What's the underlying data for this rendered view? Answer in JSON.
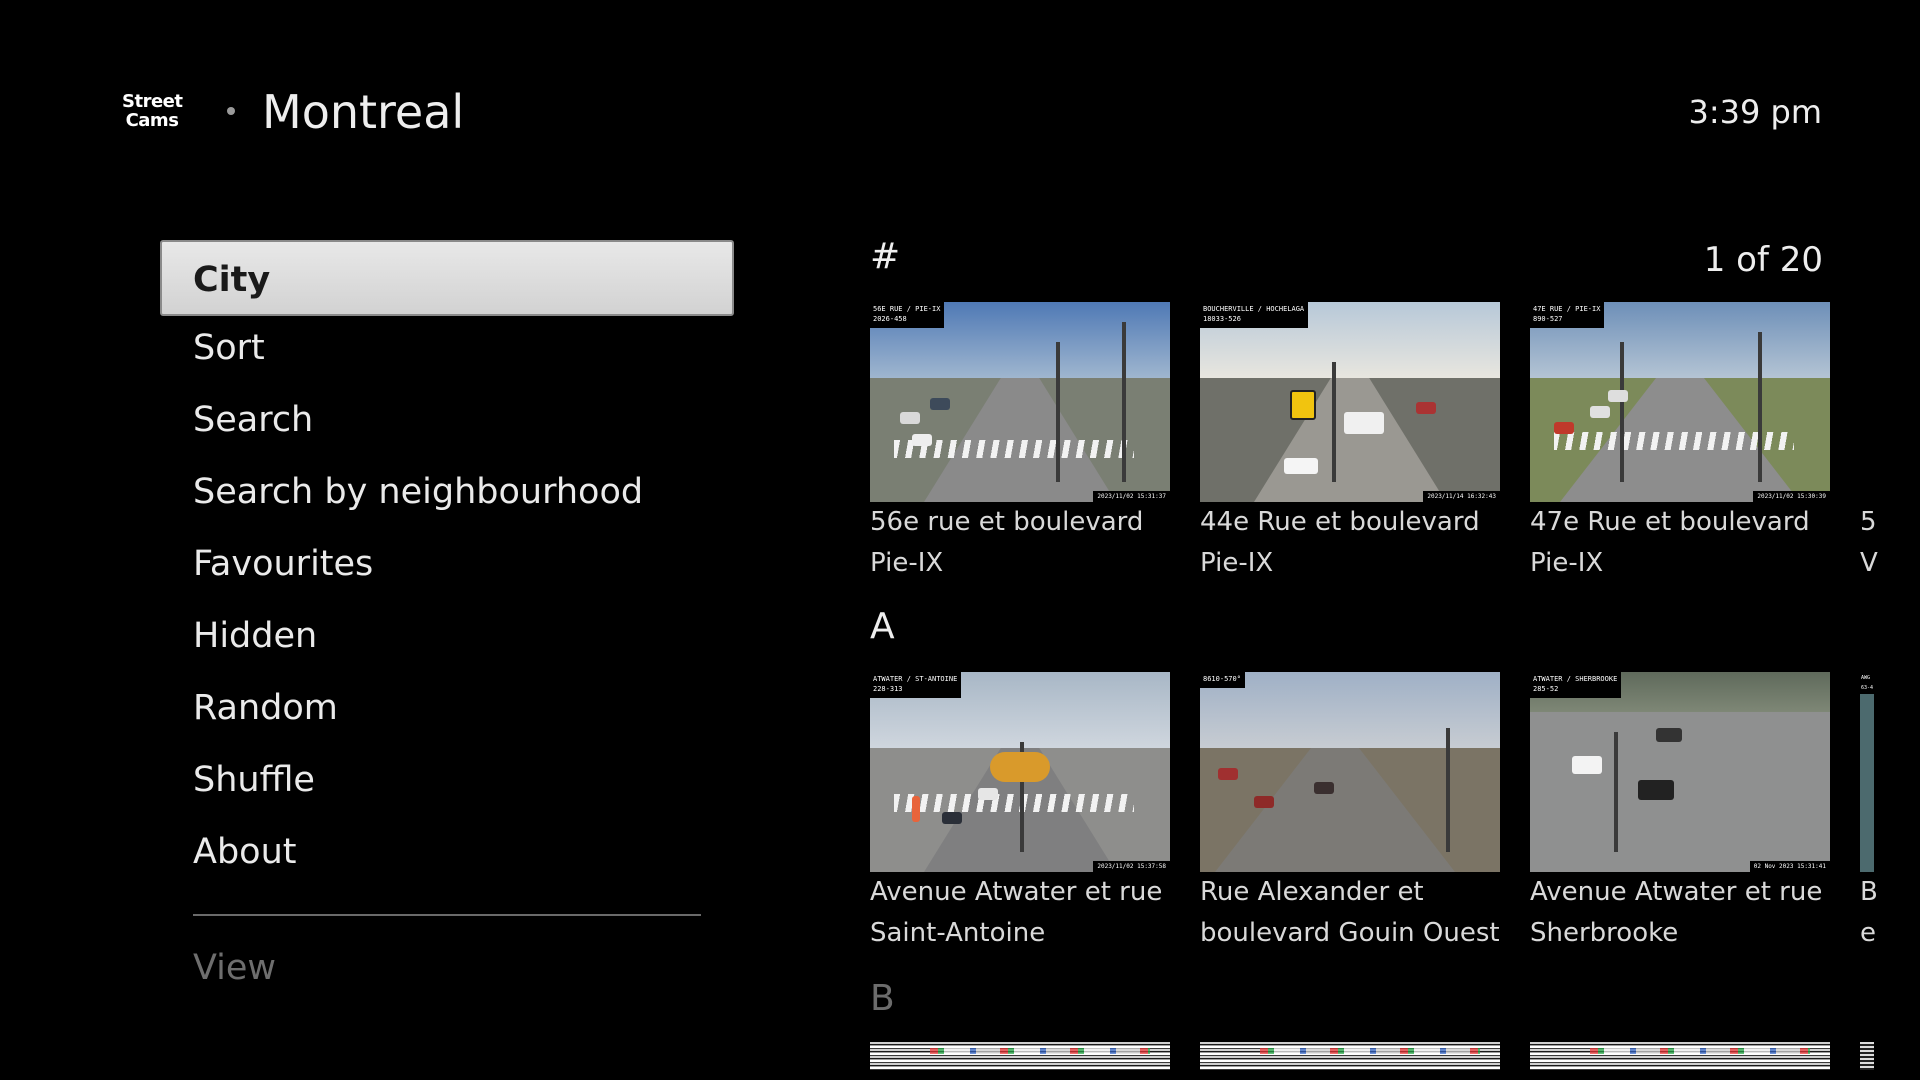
{
  "header": {
    "logo_line1": "Street",
    "logo_line2": "Cams",
    "city": "Montreal",
    "time": "3:39 pm"
  },
  "menu": {
    "items": [
      {
        "label": "City",
        "selected": true
      },
      {
        "label": "Sort"
      },
      {
        "label": "Search"
      },
      {
        "label": "Search by neighbourhood"
      },
      {
        "label": "Favourites"
      },
      {
        "label": "Hidden"
      },
      {
        "label": "Random"
      },
      {
        "label": "Shuffle"
      },
      {
        "label": "About"
      }
    ],
    "secondary": "View"
  },
  "grid": {
    "page_indicator": "1 of 20",
    "sections": [
      {
        "letter": "#",
        "cameras": [
          {
            "line1": "56e rue et boulevard",
            "line2": "Pie-IX",
            "cam_label_1": "56E RUE / PIE-IX",
            "cam_label_2": "2026-458",
            "stamp": "2023/11/02  15:31:37"
          },
          {
            "line1": "44e Rue et boulevard",
            "line2": "Pie-IX",
            "cam_label_1": "BOUCHERVILLE / HOCHELAGA",
            "cam_label_2": "18033-526",
            "stamp": "2023/11/14  16:32:43"
          },
          {
            "line1": "47e Rue et boulevard",
            "line2": "Pie-IX",
            "cam_label_1": "47E RUE / PIE-IX",
            "cam_label_2": "890-527",
            "stamp": "2023/11/02  15:30:39"
          }
        ],
        "peek": {
          "line1": "5",
          "line2": "V"
        }
      },
      {
        "letter": "A",
        "cameras": [
          {
            "line1": "Avenue Atwater et rue",
            "line2": "Saint-Antoine",
            "cam_label_1": "ATWATER / ST-ANTOINE",
            "cam_label_2": "228-313",
            "stamp": "2023/11/02  15:37:58"
          },
          {
            "line1": "Rue Alexander et",
            "line2": "boulevard Gouin Ouest",
            "cam_label_1": "8610-570°",
            "cam_label_2": "",
            "stamp": ""
          },
          {
            "line1": "Avenue Atwater et rue",
            "line2": "Sherbrooke",
            "cam_label_1": "ATWATER / SHERBROOKE",
            "cam_label_2": "285-52",
            "stamp": "02 Nov 2023  15:31:41"
          }
        ],
        "peek": {
          "line1": "B",
          "line2": "e",
          "cam_label_1": "AWG",
          "cam_label_2": "63-4"
        }
      },
      {
        "letter": "B"
      }
    ]
  },
  "colors": {
    "background": "#000000",
    "text": "#eeeeee",
    "selected_bg": "#dcdcdc",
    "dim_text": "#6e6e6e"
  }
}
